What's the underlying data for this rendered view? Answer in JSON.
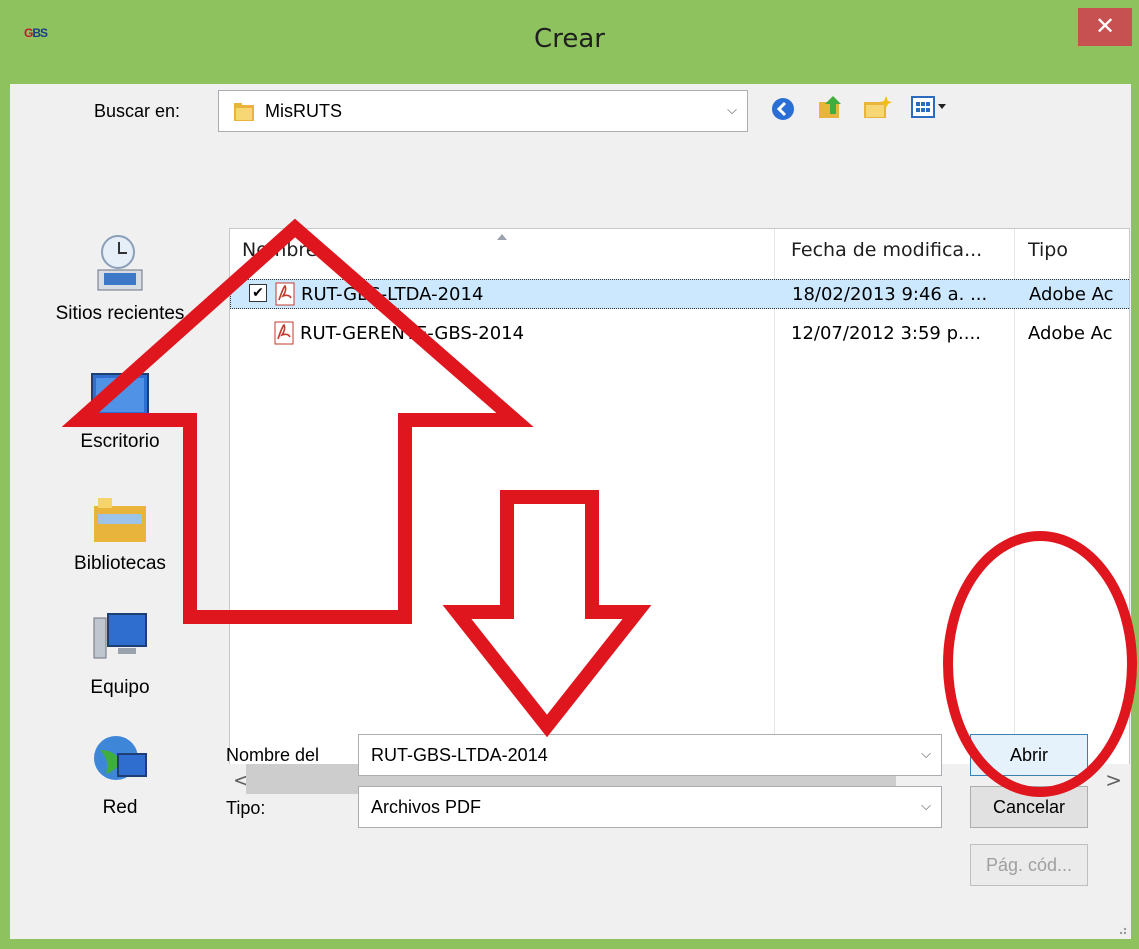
{
  "window": {
    "title": "Crear",
    "app_icon": "GBS",
    "close": "✕"
  },
  "toolbar": {
    "look_in_label": "Buscar en:",
    "look_in_value": "MisRUTS",
    "icons": [
      "back-icon",
      "up-folder-icon",
      "new-folder-icon",
      "view-menu-icon"
    ]
  },
  "places": [
    {
      "label": "Sitios recientes",
      "icon": "recent-places-icon"
    },
    {
      "label": "Escritorio",
      "icon": "desktop-icon"
    },
    {
      "label": "Bibliotecas",
      "icon": "libraries-icon"
    },
    {
      "label": "Equipo",
      "icon": "computer-icon"
    },
    {
      "label": "Red",
      "icon": "network-icon"
    }
  ],
  "columns": [
    "Nombre",
    "Fecha de modifica...",
    "Tipo"
  ],
  "files": [
    {
      "name": "RUT-GBS-LTDA-2014",
      "date": "18/02/2013 9:46 a. ...",
      "type": "Adobe Ac",
      "checkbox": "✔",
      "selected": true
    },
    {
      "name": "RUT-GERENTE-GBS-2014",
      "date": "12/07/2012 3:59 p....",
      "type": "Adobe Ac",
      "selected": false
    }
  ],
  "scroll": {
    "left": "<",
    "right": ">"
  },
  "filename": {
    "label": "Nombre del",
    "value": "RUT-GBS-LTDA-2014"
  },
  "filetype": {
    "label": "Tipo:",
    "value": "Archivos PDF"
  },
  "buttons": {
    "open": "Abrir",
    "cancel": "Cancelar",
    "codepage": "Pág. cód..."
  },
  "annotation_color": "#e0161e"
}
